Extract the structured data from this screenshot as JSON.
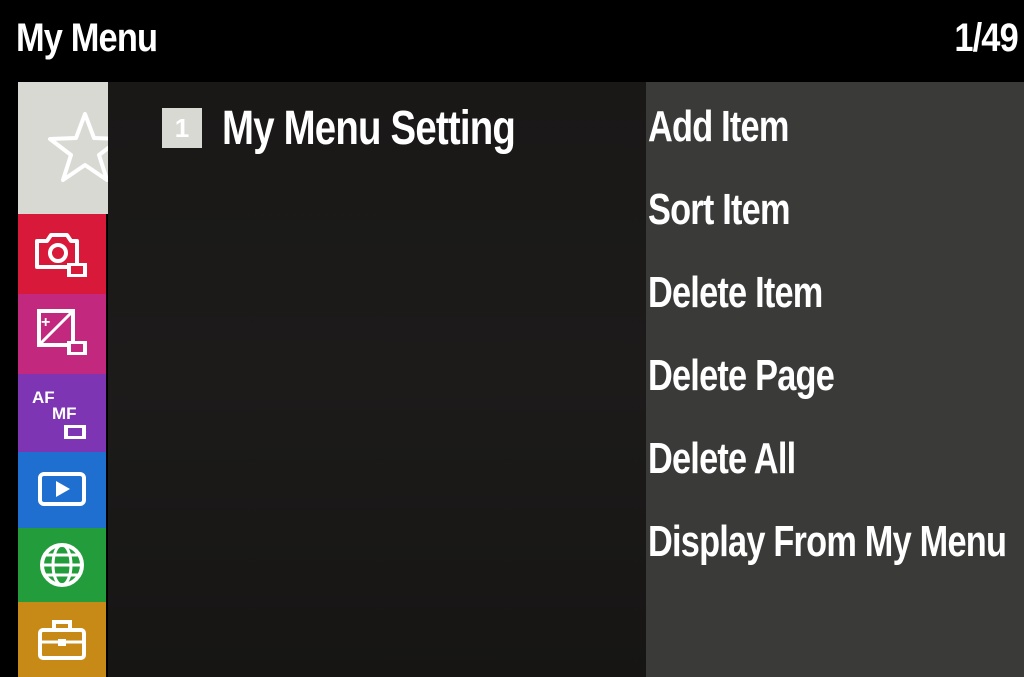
{
  "header": {
    "title": "My Menu",
    "page_counter": "1/49"
  },
  "sidebar": {
    "tabs": [
      {
        "icon": "star-icon",
        "color": "#d9d9d4",
        "active": true
      },
      {
        "icon": "camera-icon",
        "color": "#d8193a"
      },
      {
        "icon": "exposure-icon",
        "color": "#c2287e"
      },
      {
        "icon": "af-mf-icon",
        "color": "#7e35b3"
      },
      {
        "icon": "playback-icon",
        "color": "#1e6fd0"
      },
      {
        "icon": "globe-icon",
        "color": "#239c3b"
      },
      {
        "icon": "toolbox-icon",
        "color": "#c78a16"
      }
    ]
  },
  "content": {
    "page_number": "1",
    "setting_label": "My Menu Setting"
  },
  "options": {
    "items": [
      {
        "label": "Add Item"
      },
      {
        "label": "Sort Item"
      },
      {
        "label": "Delete Item"
      },
      {
        "label": "Delete Page"
      },
      {
        "label": "Delete All"
      },
      {
        "label": "Display From My Menu"
      }
    ]
  }
}
